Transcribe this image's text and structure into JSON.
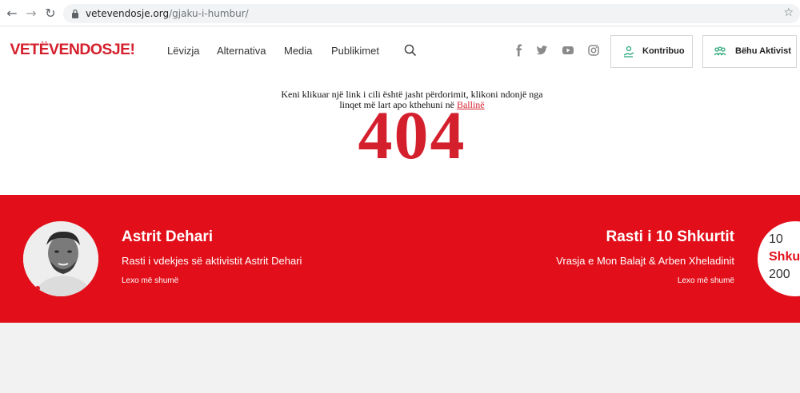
{
  "browser": {
    "back_icon": "back-arrow-icon",
    "forward_icon": "forward-arrow-icon",
    "reload_icon": "reload-icon",
    "url_domain": "vetevendosje.org",
    "url_path": "/gjaku-i-humbur/"
  },
  "header": {
    "logo": "VETËVENDOSJE!",
    "menu": [
      "Lëvizja",
      "Alternativa",
      "Media",
      "Publikimet"
    ],
    "social": [
      "facebook-icon",
      "twitter-icon",
      "youtube-icon",
      "instagram-icon"
    ],
    "contribute_label": "Kontribuo",
    "activist_label": "Bëhu Aktivist"
  },
  "error": {
    "message": "Keni klikuar një link i cili është jasht përdorimit, klikoni ndonjë nga linqet më lart apo kthehuni në",
    "home_link": "Ballinë",
    "code": "404"
  },
  "features": {
    "left": {
      "title": "Astrit Dehari",
      "subtitle": "Rasti i vdekjes së aktivistit Astrit Dehari",
      "more": "Lexo më shumë"
    },
    "right": {
      "title": "Rasti i 10 Shkurtit",
      "subtitle": "Vrasja e Mon Balajt & Arben Xheladinit",
      "more": "Lexo më shumë",
      "date_line1": "10",
      "date_line2": "Shku",
      "date_line3": "200"
    }
  },
  "colors": {
    "accent": "#e20f1a",
    "brand_red": "#d4202d"
  }
}
